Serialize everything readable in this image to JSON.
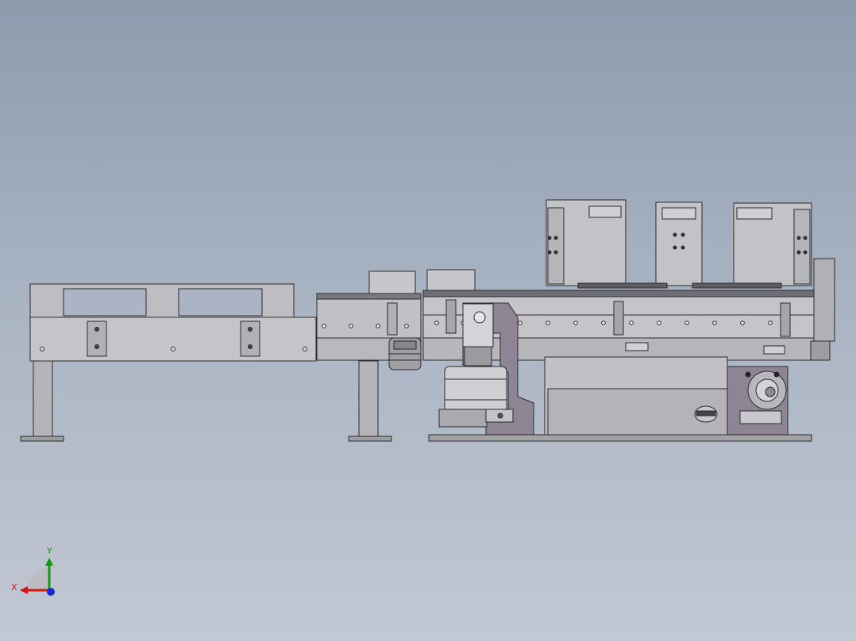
{
  "viewport": {
    "background_top": "#8d9bae",
    "background_bottom": "#c2c8d3"
  },
  "model": {
    "line_color": "#2a2a2e",
    "fill_light": "#c9c9cd",
    "fill_mid": "#a9a9ae",
    "fill_dark": "#7a7a80",
    "fill_purple": "#8e8594"
  },
  "triad": {
    "x_label": "X",
    "y_label": "Y",
    "x_color": "#d01818",
    "y_color": "#109a10",
    "z_color": "#1a2ad0"
  }
}
